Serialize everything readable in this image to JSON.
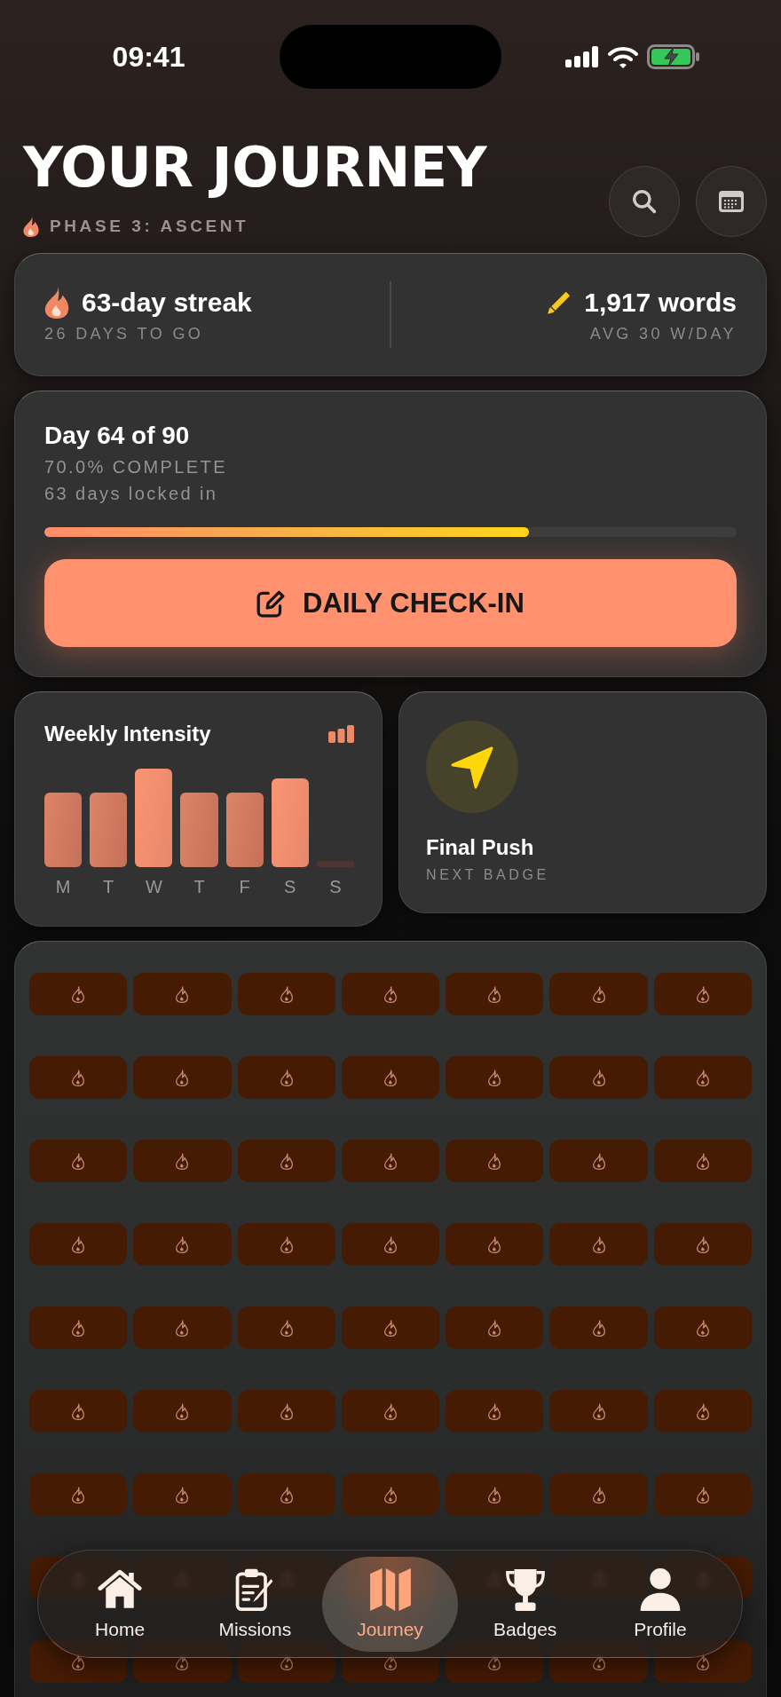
{
  "status_bar": {
    "time": "09:41"
  },
  "header": {
    "title": "YOUR JOURNEY",
    "phase": "PHASE 3: ASCENT"
  },
  "stats": {
    "streak": {
      "value": "63-day streak",
      "caption": "26 DAYS TO GO"
    },
    "words": {
      "value": "1,917 words",
      "caption": "AVG 30 W/DAY"
    }
  },
  "progress": {
    "title": "Day 64 of 90",
    "percent": "70.0% COMPLETE",
    "note": "63 days locked in",
    "level": 0.7,
    "button": "DAILY CHECK-IN"
  },
  "weekly_intensity": {
    "title": "Weekly Intensity",
    "days": [
      {
        "label": "M"
      },
      {
        "label": "T"
      },
      {
        "label": "W"
      },
      {
        "label": "T"
      },
      {
        "label": "F"
      },
      {
        "label": "S"
      },
      {
        "label": "S"
      }
    ]
  },
  "next_badge": {
    "name": "Final Push",
    "caption": "NEXT BADGE"
  },
  "calendar": {
    "days": [
      {
        "done": true
      },
      {
        "done": true
      },
      {
        "done": true
      },
      {
        "done": true
      },
      {
        "done": true
      },
      {
        "done": true
      },
      {
        "done": true
      },
      {
        "done": true
      },
      {
        "done": true
      },
      {
        "done": true
      },
      {
        "done": true
      },
      {
        "done": true
      },
      {
        "done": true
      },
      {
        "done": true
      },
      {
        "done": true
      },
      {
        "done": true
      },
      {
        "done": true
      },
      {
        "done": true
      },
      {
        "done": true
      },
      {
        "done": true
      },
      {
        "done": true
      },
      {
        "done": true
      },
      {
        "done": true
      },
      {
        "done": true
      },
      {
        "done": true
      },
      {
        "done": true
      },
      {
        "done": true
      },
      {
        "done": true
      },
      {
        "done": true
      },
      {
        "done": true
      },
      {
        "done": true
      },
      {
        "done": true
      },
      {
        "done": true
      },
      {
        "done": true
      },
      {
        "done": true
      },
      {
        "done": true
      },
      {
        "done": true
      },
      {
        "done": true
      },
      {
        "done": true
      },
      {
        "done": true
      },
      {
        "done": true
      },
      {
        "done": true
      },
      {
        "done": true
      },
      {
        "done": true
      },
      {
        "done": true
      },
      {
        "done": true
      },
      {
        "done": true
      },
      {
        "done": true
      },
      {
        "done": true
      },
      {
        "done": true
      },
      {
        "done": true
      },
      {
        "done": true
      },
      {
        "done": true
      },
      {
        "done": true
      },
      {
        "done": true
      },
      {
        "done": true
      },
      {
        "done": true
      },
      {
        "done": true
      },
      {
        "done": true
      },
      {
        "done": true
      },
      {
        "done": true
      },
      {
        "done": true
      },
      {
        "done": true
      }
    ]
  },
  "tab_bar": {
    "items": [
      {
        "label": "Home",
        "selected": false
      },
      {
        "label": "Missions",
        "selected": false
      },
      {
        "label": "Journey",
        "selected": true
      },
      {
        "label": "Badges",
        "selected": false
      },
      {
        "label": "Profile",
        "selected": false
      }
    ]
  }
}
